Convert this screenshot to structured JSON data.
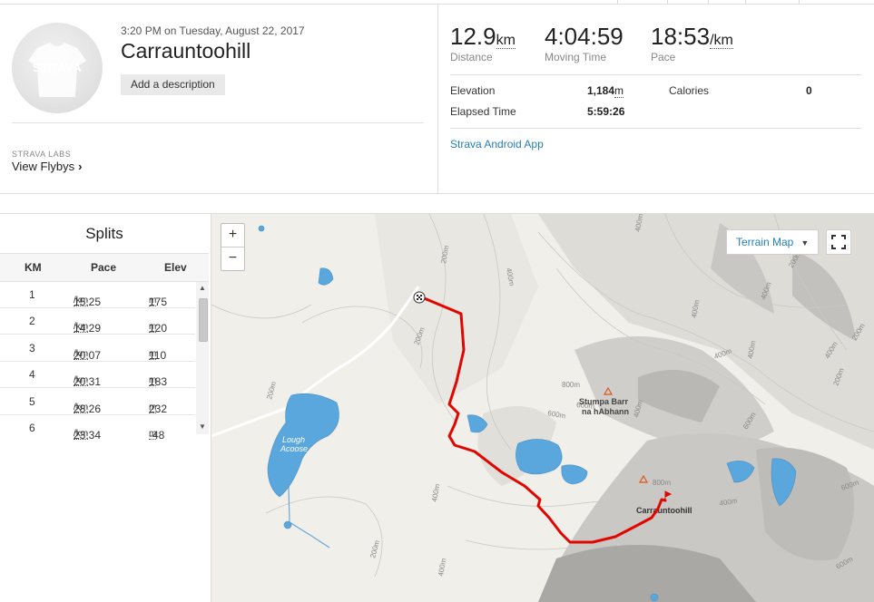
{
  "activity": {
    "date": "3:20 PM on Tuesday, August 22, 2017",
    "title": "Carrauntoohill",
    "add_description": "Add a description",
    "avatar_brand": "STRAVA"
  },
  "labs": {
    "label": "STRAVA LABS",
    "link": "View Flybys"
  },
  "stats": {
    "distance": {
      "value": "12.9",
      "unit": "km",
      "label": "Distance"
    },
    "moving_time": {
      "value": "4:04:59",
      "label": "Moving Time"
    },
    "pace": {
      "value": "18:53",
      "unit": "/km",
      "label": "Pace"
    },
    "elevation": {
      "label": "Elevation",
      "value": "1,184",
      "unit": "m"
    },
    "calories": {
      "label": "Calories",
      "value": "0"
    },
    "elapsed": {
      "label": "Elapsed Time",
      "value": "5:59:26"
    },
    "device": "Strava Android App"
  },
  "splits": {
    "title": "Splits",
    "headers": {
      "km": "KM",
      "pace": "Pace",
      "elev": "Elev"
    },
    "pace_unit": "/km",
    "elev_unit": "m",
    "rows": [
      {
        "km": "1",
        "pace": "15:25",
        "elev": "175"
      },
      {
        "km": "2",
        "pace": "14:29",
        "elev": "120"
      },
      {
        "km": "3",
        "pace": "20:07",
        "elev": "110"
      },
      {
        "km": "4",
        "pace": "20:31",
        "elev": "183"
      },
      {
        "km": "5",
        "pace": "28:26",
        "elev": "232"
      },
      {
        "km": "6",
        "pace": "23:34",
        "elev": "-48"
      }
    ]
  },
  "map": {
    "zoom_in": "+",
    "zoom_out": "−",
    "map_type": "Terrain Map",
    "labels": {
      "lough": "Lough",
      "acoose": "Acoose",
      "stumpa1": "Stumpa Barr",
      "stumpa2": "na hAbhann",
      "summit": "Carrauntoohill"
    },
    "contours": [
      "400m",
      "200m",
      "200m",
      "400m",
      "200m",
      "400m",
      "600m",
      "800m",
      "600m",
      "800m",
      "400m",
      "200m",
      "400m",
      "400m",
      "200m",
      "400m",
      "200m",
      "200m",
      "600m",
      "400m",
      "600m",
      "600m",
      "400m",
      "400m",
      "400m"
    ],
    "route_color": "#e10600"
  }
}
